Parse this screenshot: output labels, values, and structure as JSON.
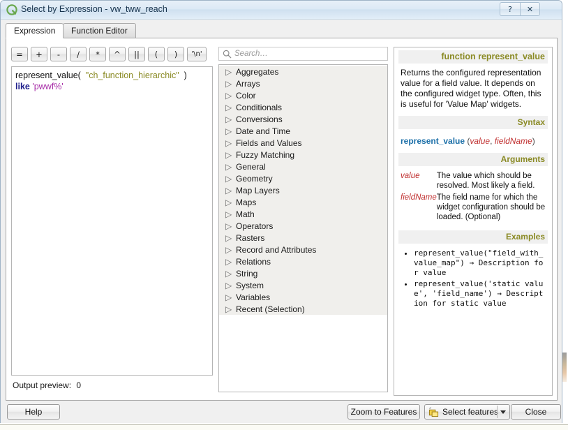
{
  "window": {
    "title": "Select by Expression - vw_tww_reach",
    "icon_name": "qgis-logo-icon",
    "help_button_glyph": "?",
    "close_button_glyph": "✕"
  },
  "tabs": [
    {
      "label": "Expression",
      "active": true
    },
    {
      "label": "Function Editor",
      "active": false
    }
  ],
  "operator_buttons": [
    {
      "label": "=",
      "name": "op-equals"
    },
    {
      "label": "+",
      "name": "op-plus"
    },
    {
      "label": "-",
      "name": "op-minus"
    },
    {
      "label": "/",
      "name": "op-divide"
    },
    {
      "label": "*",
      "name": "op-multiply"
    },
    {
      "label": "^",
      "name": "op-power"
    },
    {
      "label": "||",
      "name": "op-concat"
    },
    {
      "label": "(",
      "name": "op-open-paren"
    },
    {
      "label": ")",
      "name": "op-close-paren"
    },
    {
      "label": "'\\n'",
      "name": "op-newline"
    }
  ],
  "expression": {
    "line1_fn": "represent_value(  ",
    "line1_field": "\"ch_function_hierarchic\"",
    "line1_close": "  )",
    "line2_kw": "like",
    "line2_str": " 'pwwf%'"
  },
  "output_preview": {
    "label": "Output preview:",
    "value": "0"
  },
  "search": {
    "placeholder": "Search…",
    "value": "",
    "icon_name": "search-icon"
  },
  "function_tree": [
    "Aggregates",
    "Arrays",
    "Color",
    "Conditionals",
    "Conversions",
    "Date and Time",
    "Fields and Values",
    "Fuzzy Matching",
    "General",
    "Geometry",
    "Map Layers",
    "Maps",
    "Math",
    "Operators",
    "Rasters",
    "Record and Attributes",
    "Relations",
    "String",
    "System",
    "Variables",
    "Recent (Selection)"
  ],
  "help": {
    "title": "function represent_value",
    "description": "Returns the configured representation value for a field value. It depends on the configured widget type. Often, this is useful for 'Value Map' widgets.",
    "syntax_heading": "Syntax",
    "syntax_fn": "represent_value",
    "syntax_open": " (",
    "syntax_arg1": "value",
    "syntax_comma": ", ",
    "syntax_arg2": "fieldName",
    "syntax_close": ")",
    "arguments_heading": "Arguments",
    "arguments": [
      {
        "name": "value",
        "description": "The value which should be resolved. Most likely a field."
      },
      {
        "name": "fieldName",
        "description": "The field name for which the widget configuration should be loaded. (Optional)"
      }
    ],
    "examples_heading": "Examples",
    "examples": [
      "represent_value(\"field_with_value_map\") → Description for value",
      "represent_value('static value', 'field_name') → Description for static value"
    ]
  },
  "buttons": {
    "help": "Help",
    "zoom_to_features": "Zoom to Features",
    "select_features": "Select features",
    "select_features_icon": "select-features-icon",
    "close": "Close"
  },
  "colors": {
    "accent_olive": "#8a8a24",
    "keyword_blue": "#1f1f8c",
    "string_magenta": "#a72ca7",
    "arg_red": "#c03030",
    "syntax_blue": "#1b6fa8",
    "titlebar_blue": "#cfe0f0"
  }
}
